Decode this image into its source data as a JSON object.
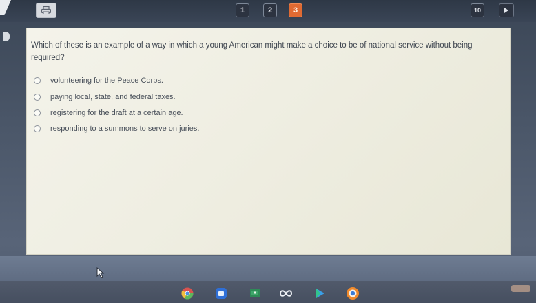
{
  "nav": {
    "question_numbers": [
      "1",
      "2",
      "3"
    ],
    "last_question": "10"
  },
  "question": {
    "text": "Which of these is an example of a way in which a young American might make a choice to be of national service without being required?",
    "options": [
      "volunteering for the Peace Corps.",
      "paying local, state, and federal taxes.",
      "registering for the draft at a certain age.",
      "responding to a summons to serve on juries."
    ]
  },
  "dock": {
    "icons": [
      "chrome-icon",
      "files-icon",
      "classroom-icon",
      "infinity-icon",
      "play-store-icon",
      "camera-icon"
    ]
  },
  "colors": {
    "current_question": "#e06a32",
    "card_background": "#f1f0e5",
    "desktop_background": "#4a5668"
  }
}
